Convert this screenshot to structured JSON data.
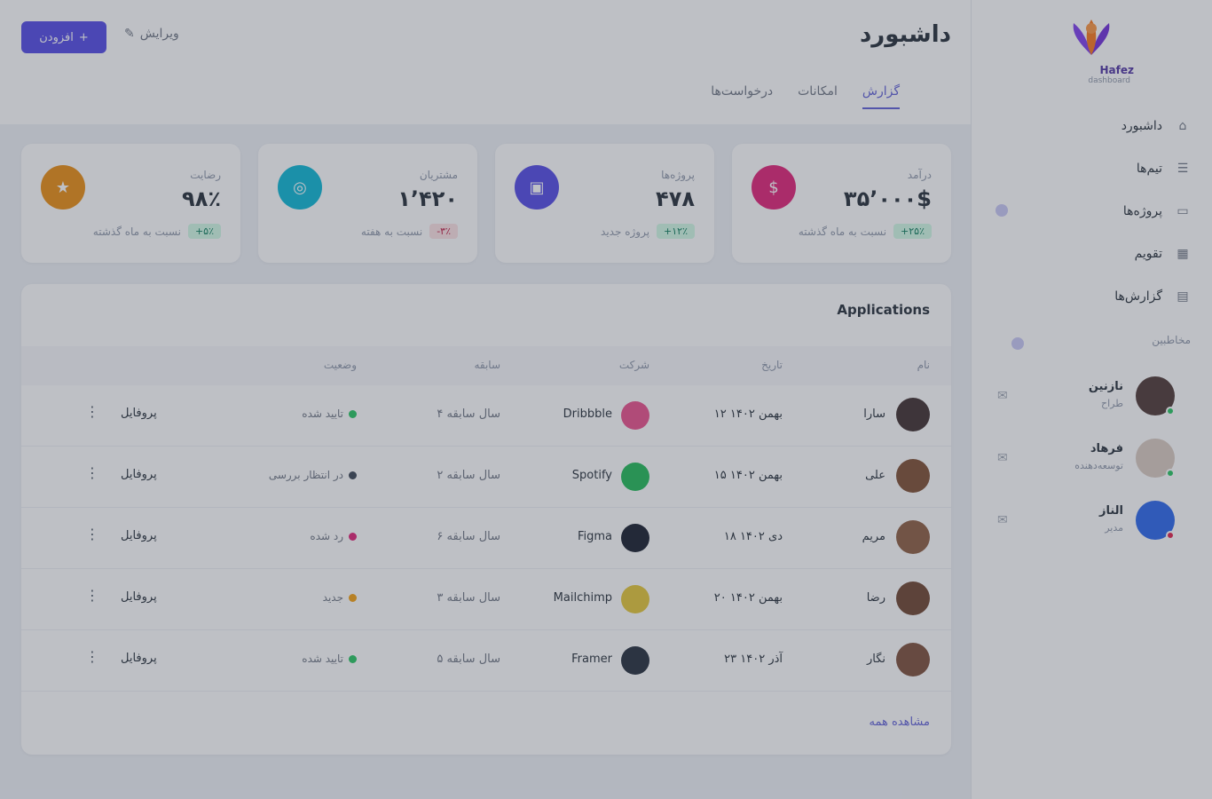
{
  "header": {
    "title": "داشبورد",
    "new_button_label": "افزودن",
    "edit_label": "ویرایش",
    "tabs": [
      "گزارش",
      "امکانات",
      "درخواست‌ها"
    ]
  },
  "stats": [
    {
      "label": "درآمد",
      "value": "۳۵٬۰۰۰$",
      "badge": "+۲۵٪",
      "trend": "up",
      "delta_text": "نسبت به ماه گذشته",
      "icon": "dollar-icon",
      "color": "#e11d74"
    },
    {
      "label": "پروژه‌ها",
      "value": "۴۷۸",
      "badge": "+۱۲٪",
      "trend": "up",
      "delta_text": "پروژه جدید",
      "icon": "briefcase-icon",
      "color": "#4f46e5"
    },
    {
      "label": "مشتریان",
      "value": "۱٬۴۲۰",
      "badge": "-۳٪",
      "trend": "down",
      "delta_text": "نسبت به هفته",
      "icon": "users-icon",
      "color": "#06b6d4"
    },
    {
      "label": "رضایت",
      "value": "۹۸٪",
      "badge": "+۵٪",
      "trend": "up",
      "delta_text": "نسبت به ماه گذشته",
      "icon": "star-icon",
      "color": "#ea8a0c"
    }
  ],
  "table": {
    "title": "Applications",
    "columns": [
      "نام",
      "تاریخ",
      "شرکت",
      "سابقه",
      "وضعیت"
    ],
    "rows": [
      {
        "name": "سارا",
        "date": "۱۲ بهمن ۱۴۰۲",
        "company": "Dribbble",
        "company_logo": "dribbble-logo",
        "logo_color": "#ea4c89",
        "tenure": "۴ سال سابقه",
        "status": "تایید شده",
        "status_color": "#22c55e",
        "action": "پروفایل",
        "avatar_color": "#3b2a2a"
      },
      {
        "name": "علی",
        "date": "۱۵ بهمن ۱۴۰۲",
        "company": "Spotify",
        "company_logo": "spotify-logo",
        "logo_color": "#1db954",
        "tenure": "۲ سال سابقه",
        "status": "در انتظار بررسی",
        "status_color": "#374151",
        "action": "پروفایل",
        "avatar_color": "#7c4a2d"
      },
      {
        "name": "مریم",
        "date": "۱۸ دی ۱۴۰۲",
        "company": "Figma",
        "company_logo": "figma-logo",
        "logo_color": "#111827",
        "tenure": "۶ سال سابقه",
        "status": "رد شده",
        "status_color": "#e11d74",
        "action": "پروفایل",
        "avatar_color": "#8b5a3c"
      },
      {
        "name": "رضا",
        "date": "۲۰ بهمن ۱۴۰۲",
        "company": "Mailchimp",
        "company_logo": "mailchimp-logo",
        "logo_color": "#e3c532",
        "tenure": "۳ سال سابقه",
        "status": "جدید",
        "status_color": "#f59e0b",
        "action": "پروفایل",
        "avatar_color": "#6b3f2a"
      },
      {
        "name": "نگار",
        "date": "۲۳ آذر ۱۴۰۲",
        "company": "Framer",
        "company_logo": "framer-logo",
        "logo_color": "#1f2937",
        "tenure": "۵ سال سابقه",
        "status": "تایید شده",
        "status_color": "#22c55e",
        "action": "پروفایل",
        "avatar_color": "#7a4b35"
      }
    ],
    "view_all": "مشاهده همه"
  },
  "sidebar": {
    "brand": "Hafez",
    "brand_sub": "dashboard",
    "nav": [
      {
        "label": "داشبورد",
        "icon": "home-icon"
      },
      {
        "label": "تیم‌ها",
        "icon": "users-icon"
      },
      {
        "label": "پروژه‌ها",
        "icon": "folder-icon"
      },
      {
        "label": "تقویم",
        "icon": "calendar-icon"
      },
      {
        "label": "گزارش‌ها",
        "icon": "chart-icon"
      }
    ],
    "section_title": "مخاطبین",
    "contacts": [
      {
        "name": "نازنین",
        "role": "طراح",
        "avatar_color": "#4a3330",
        "online_color": "#22c55e"
      },
      {
        "name": "فرهاد",
        "role": "توسعه‌دهنده",
        "avatar_color": "#d9c9bf",
        "online_color": "#22c55e"
      },
      {
        "name": "الناز",
        "role": "مدیر",
        "avatar_color": "#2563eb",
        "online_color": "#e11d48"
      }
    ]
  }
}
